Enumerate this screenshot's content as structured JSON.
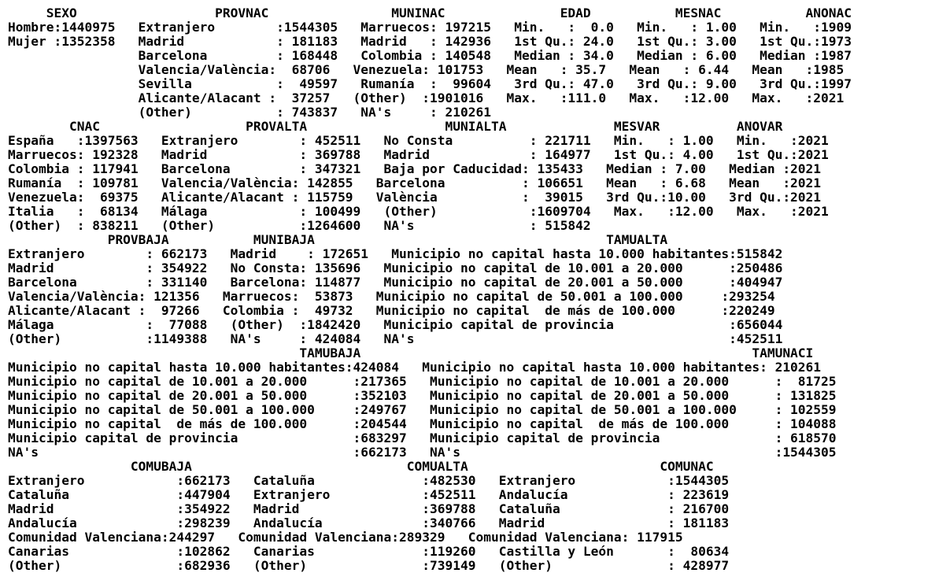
{
  "output_lines": [
    "     SEXO                  PROVNAC                MUNINAC               EDAD           MESNAC           ANONAC",
    "Hombre:1440975   Extranjero        :1544305   Marruecos: 197215   Min.   :  0.0   Min.   : 1.00   Min.   :1909",
    "Mujer :1352358   Madrid            : 181183   Madrid   : 142936   1st Qu.: 24.0   1st Qu.: 3.00   1st Qu.:1973",
    "                 Barcelona         : 168448   Colombia : 140548   Median : 34.0   Median : 6.00   Median :1987",
    "                 Valencia/València:  68706   Venezuela: 101753   Mean   : 35.7   Mean   : 6.44   Mean   :1985",
    "                 Sevilla           :  49597   Rumanía  :  99604   3rd Qu.: 47.0   3rd Qu.: 9.00   3rd Qu.:1997",
    "                 Alicante/Alacant :  37257   (Other)  :1901016   Max.   :111.0   Max.   :12.00   Max.   :2021",
    "                 (Other)           : 743837   NA's     : 210261",
    "        CNAC                   PROVALTA                  MUNIALTA              MESVAR          ANOVAR",
    "España   :1397563   Extranjero        : 452511   No Consta          : 221711   Min.   : 1.00   Min.   :2021",
    "Marruecos: 192328   Madrid            : 369788   Madrid             : 164977   1st Qu.: 4.00   1st Qu.:2021",
    "Colombia : 117941   Barcelona         : 347321   Baja por Caducidad: 135433   Median : 7.00   Median :2021",
    "Rumanía  : 109781   Valencia/València: 142855   Barcelona          : 106651   Mean   : 6.68   Mean   :2021",
    "Venezuela:  69375   Alicante/Alacant : 115759   València           :  39015   3rd Qu.:10.00   3rd Qu.:2021",
    "Italia   :  68134   Málaga            : 100499   (Other)            :1609704   Max.   :12.00   Max.   :2021",
    "(Other)  : 838211   (Other)           :1264600   NA's               : 515842",
    "             PROVBAJA           MUNIBAJA                                      TAMUALTA",
    "Extranjero        : 662173   Madrid    : 172651   Municipio no capital hasta 10.000 habitantes:515842",
    "Madrid            : 354922   No Consta: 135696   Municipio no capital de 10.001 a 20.000      :250486",
    "Barcelona         : 331140   Barcelona: 114877   Municipio no capital de 20.001 a 50.000      :404947",
    "Valencia/València: 121356   Marruecos:  53873   Municipio no capital de 50.001 a 100.000     :293254",
    "Alicante/Alacant :  97266   Colombia :  49732   Municipio no capital  de más de 100.000      :220249",
    "Málaga            :  77088   (Other)  :1842420   Municipio capital de provincia               :656044",
    "(Other)           :1149388   NA's     : 424084   NA's                                         :452511",
    "                                      TAMUBAJA                                                   TAMUNACI",
    "Municipio no capital hasta 10.000 habitantes:424084   Municipio no capital hasta 10.000 habitantes: 210261",
    "Municipio no capital de 10.001 a 20.000      :217365   Municipio no capital de 10.001 a 20.000      :  81725",
    "Municipio no capital de 20.001 a 50.000      :352103   Municipio no capital de 20.001 a 50.000      : 131825",
    "Municipio no capital de 50.001 a 100.000     :249767   Municipio no capital de 50.001 a 100.000     : 102559",
    "Municipio no capital  de más de 100.000      :204544   Municipio no capital  de más de 100.000      : 104088",
    "Municipio capital de provincia               :683297   Municipio capital de provincia               : 618570",
    "NA's                                         :662173   NA's                                         :1544305",
    "                COMUBAJA                            COMUALTA                         COMUNAC",
    "Extranjero            :662173   Cataluña              :482530   Extranjero            :1544305",
    "Cataluña              :447904   Extranjero            :452511   Andalucía             : 223619",
    "Madrid                :354922   Madrid                :369788   Cataluña              : 216700",
    "Andalucía             :298239   Andalucía             :340766   Madrid                : 181183",
    "Comunidad Valenciana:244297   Comunidad Valenciana:289329   Comunidad Valenciana: 117915",
    "Canarias              :102862   Canarias              :119260   Castilla y León       :  80634",
    "(Other)               :682936   (Other)               :739149   (Other)               : 428977"
  ]
}
